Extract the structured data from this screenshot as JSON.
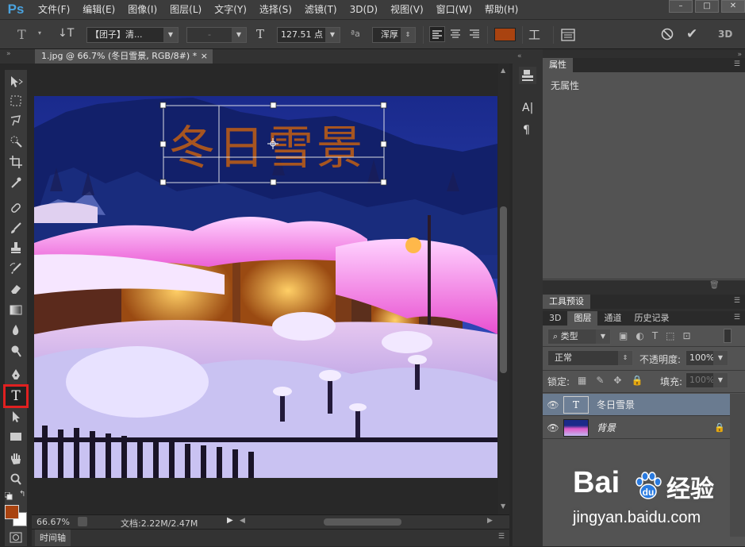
{
  "app": {
    "logo": "Ps"
  },
  "menu": [
    "文件(F)",
    "编辑(E)",
    "图像(I)",
    "图层(L)",
    "文字(Y)",
    "选择(S)",
    "滤镜(T)",
    "3D(D)",
    "视图(V)",
    "窗口(W)",
    "帮助(H)"
  ],
  "window_controls": {
    "min": "–",
    "max": "□",
    "close": "✕"
  },
  "options": {
    "font_family": "【团子】清...",
    "font_style": "-",
    "font_size": "127.51 点",
    "antialias_icon": "ªa",
    "antialias": "浑厚",
    "text_color": "#a94310",
    "commit_3d": "3D"
  },
  "document": {
    "tab_title": "1.jpg @ 66.7% (冬日雪景, RGB/8#) *",
    "tab_close": "×",
    "text_layer": "冬日雪景",
    "text_color": "#b45a1a"
  },
  "status": {
    "zoom": "66.67%",
    "doc": "文档:2.22M/2.47M"
  },
  "timeline": {
    "label": "时间轴"
  },
  "properties": {
    "tab": "属性",
    "empty": "无属性"
  },
  "tool_presets": {
    "tab": "工具预设"
  },
  "layers_panel": {
    "tabs": [
      "3D",
      "图层",
      "通道",
      "历史记录"
    ],
    "active_tab": "图层",
    "filter": "类型",
    "blend": "正常",
    "opacity_label": "不透明度:",
    "opacity": "100%",
    "lock_label": "锁定:",
    "fill_label": "填充:",
    "fill": "100%",
    "layers": [
      {
        "name": "冬日雪景",
        "type": "text",
        "thumb": "T"
      },
      {
        "name": "背景",
        "type": "image",
        "locked": true
      }
    ]
  },
  "watermark": {
    "brand": "Bai",
    "brand2": "经验",
    "url": "jingyan.baidu.com"
  },
  "colors": {
    "foreground": "#a94310",
    "background": "#ffffff",
    "highlight": "#e02020"
  }
}
